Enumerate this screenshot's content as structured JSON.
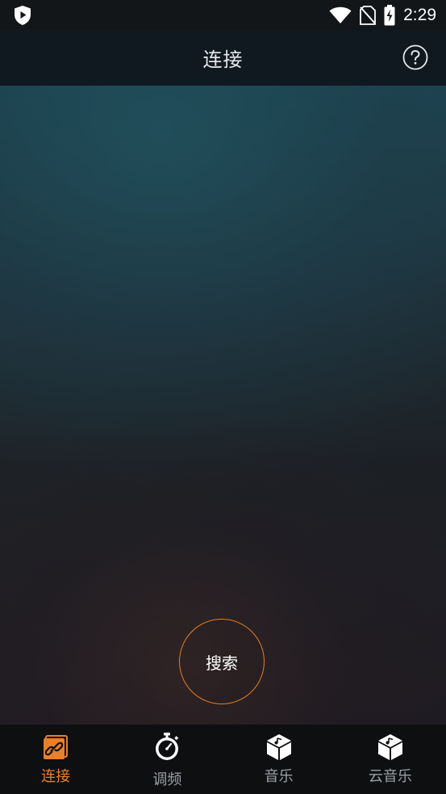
{
  "status_bar": {
    "time": "2:29",
    "icons": [
      "shield-play-icon",
      "wifi-icon",
      "no-sim-icon",
      "battery-charging-icon"
    ]
  },
  "header": {
    "title": "连接",
    "help_icon": "help-circle-icon"
  },
  "main": {
    "search_label": "搜索"
  },
  "bottom_nav": {
    "items": [
      {
        "label": "连接",
        "icon": "link-card-icon",
        "active": true
      },
      {
        "label": "调频",
        "icon": "stopwatch-icon",
        "active": false
      },
      {
        "label": "音乐",
        "icon": "music-box-icon",
        "active": false
      },
      {
        "label": "云音乐",
        "icon": "cloud-music-box-icon",
        "active": false
      }
    ]
  },
  "colors": {
    "accent": "#e8802a",
    "header_bg": "#101820",
    "nav_bg": "#0e0f11",
    "inactive_label": "#9aa0a6"
  }
}
